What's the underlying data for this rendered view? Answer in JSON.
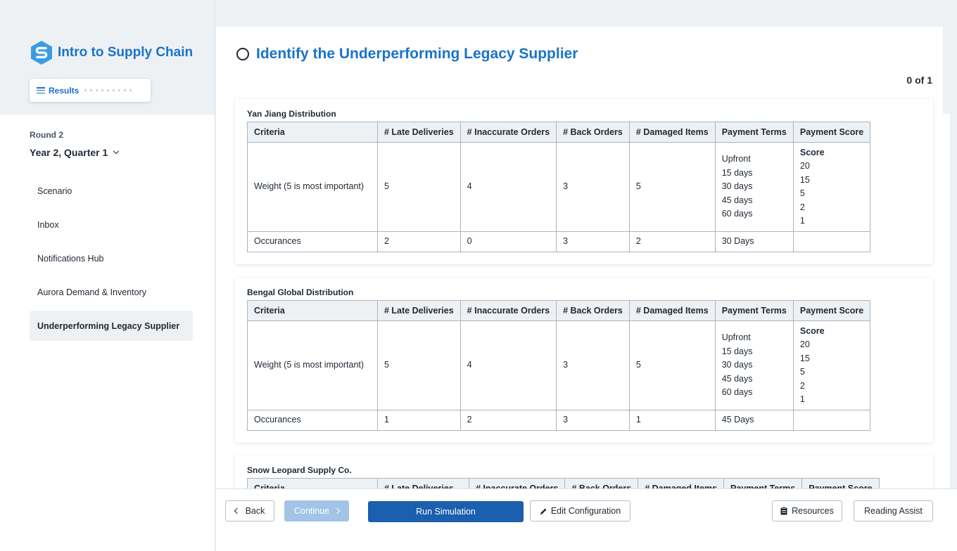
{
  "sidebar": {
    "brand_title": "Intro to Supply Chain",
    "results_label": "Results",
    "round_label": "Round 2",
    "quarter_label": "Year 2, Quarter 1",
    "items": [
      {
        "label": "Scenario"
      },
      {
        "label": "Inbox"
      },
      {
        "label": "Notifications Hub"
      },
      {
        "label": "Aurora Demand & Inventory"
      },
      {
        "label": "Underperforming Legacy Supplier"
      }
    ]
  },
  "main": {
    "title": "Identify the Underperforming Legacy Supplier",
    "counter": "0 of 1",
    "columns": [
      "Criteria",
      "# Late Deliveries",
      "# Inaccurate Orders",
      "# Back Orders",
      "# Damaged Items",
      "Payment Terms",
      "Payment Score"
    ],
    "weight_label": "Weight (5 is most important)",
    "occurrences_label": "Occurances",
    "weights": [
      "5",
      "4",
      "3",
      "5"
    ],
    "payment_terms": [
      "Upfront",
      "15 days",
      "30 days",
      "45 days",
      "60 days"
    ],
    "score_head": "Score",
    "scores": [
      "20",
      "15",
      "5",
      "2",
      "1"
    ],
    "suppliers": [
      {
        "name": "Yan Jiang Distribution",
        "occurrences": [
          "2",
          "0",
          "3",
          "2"
        ],
        "terms": "30 Days"
      },
      {
        "name": "Bengal Global Distribution",
        "occurrences": [
          "1",
          "2",
          "3",
          "1"
        ],
        "terms": "45 Days"
      },
      {
        "name": "Snow Leopard Supply Co."
      }
    ]
  },
  "footer": {
    "back_label": "Back",
    "continue_label": "Continue",
    "run_label": "Run Simulation",
    "edit_label": "Edit Configuration",
    "resources_label": "Resources",
    "reading_label": "Reading Assist"
  },
  "colors": {
    "accent": "#1a73c8",
    "primary_button": "#1c5fae",
    "disabled_button": "#a3c4e6",
    "table_header": "#eef1f4"
  }
}
